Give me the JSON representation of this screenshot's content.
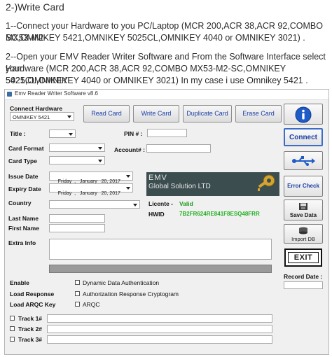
{
  "instructions": {
    "heading": "2-)Write Card",
    "step1_line1": "1--Connect your Hardware to you PC/Laptop (MCR 200,ACR 38,ACR 92,COMBO MX53-M2-",
    "step1_line2": "SC,OMNIKEY 5421,OMNIKEY 5025CL,OMNIKEY 4040 or OMNIKEY 3021) .",
    "step2_line1": "2--Open your EMV Reader Writer Software and From the Software Interface select your",
    "step2_line2": "Hardware (MCR 200,ACR 38,ACR 92,COMBO MX53-M2-SC,OMNIKEY 5421,OMNIKEY",
    "step2_line3": "5025CL,OMNIKEY 4040 or OMNIKEY 3021) In my case i use Omnikey 5421 ."
  },
  "window": {
    "title": "Emv Reader Writer Software v8.6",
    "connect_hardware_label": "Connect Hardware",
    "hardware_selected": "OMNIKEY 5421",
    "buttons": {
      "read_card": "Read Card",
      "write_card": "Write Card",
      "duplicate_card": "Duplicate Card",
      "erase_card": "Erase Card",
      "connect": "Connect",
      "error_check": "Error Check",
      "save_data": "Save Data",
      "import_db": "Import DB",
      "exit": "EXIT"
    },
    "labels": {
      "title": "Title :",
      "pin": "PIN # :",
      "card_format": "Card Format",
      "account": "Account# :",
      "card_type": "Card Type",
      "issue_date": "Issue Date",
      "expiry_date": "Expiry Date",
      "country": "Country",
      "last_name": "Last Name",
      "first_name": "First Name",
      "extra_info": "Extra Info",
      "licente": "Licente -",
      "hwid": "HWID",
      "record_date": "Record Date :",
      "enable": "Enable",
      "load_response": "Load Response",
      "load_arqc_key": "Load ARQC Key",
      "track1": "Track 1#",
      "track2": "Track 2#",
      "track3": "Track 3#"
    },
    "values": {
      "licente_status": "Valid",
      "hwid": "7B2FR624RE841F8ESQ48FRR",
      "issue_date": "Friday  ,   January   20, 2017",
      "expiry_date": "Friday  ,   January   20, 2017"
    },
    "options": {
      "dynamic_auth": "Dynamic Data Authentication",
      "auth_response": "Authorization Response Cryptogram",
      "arqc": "ARQC"
    },
    "banner": {
      "line1": "EMV",
      "line2": "Global Solution LTD"
    },
    "colors": {
      "valid_green": "#1e9a1e",
      "hwid_green": "#22b022",
      "button_text_blue": "#1a3fa8",
      "banner_bg": "#3b4d4f",
      "info_blue": "#1f5cc8"
    },
    "icons": [
      "info-icon",
      "usb-icon",
      "save-icon",
      "import-db-icon",
      "key-icon",
      "app-icon"
    ]
  }
}
